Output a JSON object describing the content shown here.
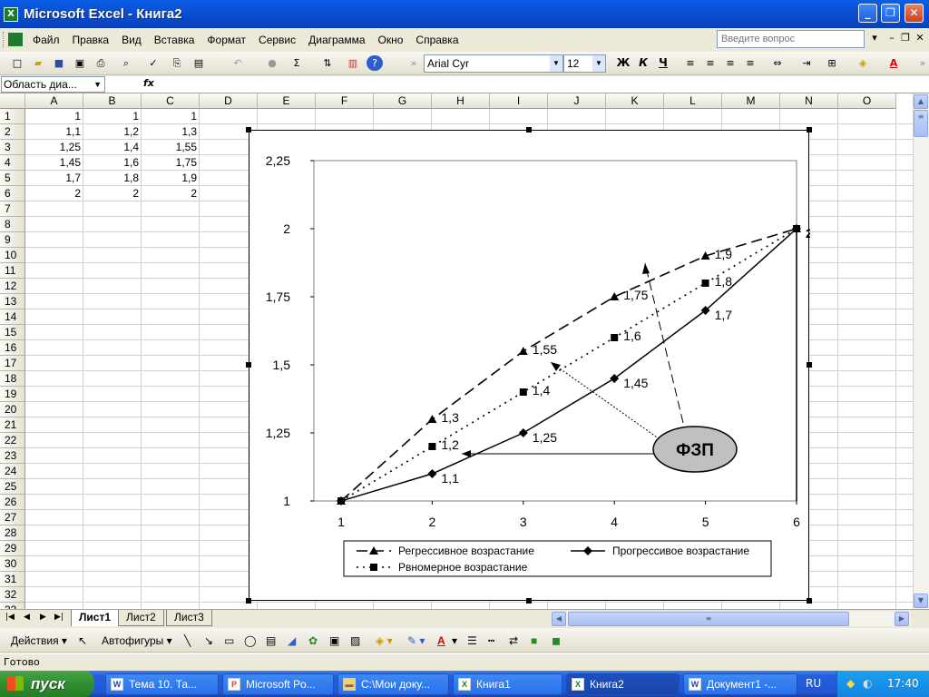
{
  "window": {
    "title": "Microsoft Excel - Книга2",
    "icon": "excel-icon"
  },
  "menu": [
    "Файл",
    "Правка",
    "Вид",
    "Вставка",
    "Формат",
    "Сервис",
    "Диаграмма",
    "Окно",
    "Справка"
  ],
  "help_box": {
    "placeholder": "Введите вопрос"
  },
  "toolbar": {
    "font": "Arial Cyr",
    "size": "12",
    "bold": "Ж",
    "italic": "К",
    "underline": "Ч",
    "sum": "Σ"
  },
  "formula_bar": {
    "name_box": "Область диа...",
    "fx": "fx"
  },
  "sheet": {
    "columns": [
      "A",
      "B",
      "C",
      "D",
      "E",
      "F",
      "G",
      "H",
      "I",
      "J",
      "K",
      "L",
      "M",
      "N",
      "O"
    ],
    "rows": [
      "1",
      "2",
      "3",
      "4",
      "5",
      "6",
      "7",
      "8",
      "9",
      "10",
      "11",
      "12",
      "13",
      "14",
      "15",
      "16",
      "17",
      "18",
      "19",
      "20",
      "21",
      "22",
      "23",
      "24",
      "25",
      "26",
      "27",
      "28",
      "29",
      "30",
      "31",
      "32",
      "33"
    ],
    "cells": [
      [
        "1",
        "1",
        "1"
      ],
      [
        "1,1",
        "1,2",
        "1,3"
      ],
      [
        "1,25",
        "1,4",
        "1,55"
      ],
      [
        "1,45",
        "1,6",
        "1,75"
      ],
      [
        "1,7",
        "1,8",
        "1,9"
      ],
      [
        "2",
        "2",
        "2"
      ]
    ]
  },
  "tabs": [
    "Лист1",
    "Лист2",
    "Лист3"
  ],
  "drawing": {
    "actions": "Действия",
    "autoshapes": "Автофигуры"
  },
  "status": "Готово",
  "taskbar": {
    "start": "пуск",
    "items": [
      "Тема 10. Та...",
      "Microsoft Po...",
      "C:\\Мои доку...",
      "Книга1",
      "Книга2",
      "Документ1 -..."
    ],
    "lang": "RU",
    "clock": "17:40"
  },
  "chart_data": {
    "type": "line",
    "x": [
      1,
      2,
      3,
      4,
      5,
      6
    ],
    "xticks": [
      "1",
      "2",
      "3",
      "4",
      "5",
      "6"
    ],
    "yticks": [
      "1",
      "1,25",
      "1,5",
      "1,75",
      "2",
      "2,25"
    ],
    "ylim": [
      1,
      2.25
    ],
    "xlim": [
      1,
      6
    ],
    "series": [
      {
        "name": "Регрессивное возрастание",
        "values": [
          1,
          1.3,
          1.55,
          1.75,
          1.9,
          2
        ],
        "labels": [
          "",
          "1,3",
          "1,55",
          "1,75",
          "1,9",
          ""
        ],
        "marker": "triangle",
        "dash": "dashed"
      },
      {
        "name": "Рвномерное возрастание",
        "values": [
          1,
          1.2,
          1.4,
          1.6,
          1.8,
          2
        ],
        "labels": [
          "",
          "1,2",
          "1,4",
          "1,6",
          "1,8",
          ""
        ],
        "marker": "square",
        "dash": "dotted"
      },
      {
        "name": "Прогрессивое возрастание",
        "values": [
          1,
          1.1,
          1.25,
          1.45,
          1.7,
          2
        ],
        "labels": [
          "",
          "1,1",
          "1,25",
          "1,45",
          "1,7",
          "2"
        ],
        "marker": "diamond",
        "dash": "solid"
      }
    ],
    "callout": "ФЗП",
    "legend_position": "bottom"
  }
}
